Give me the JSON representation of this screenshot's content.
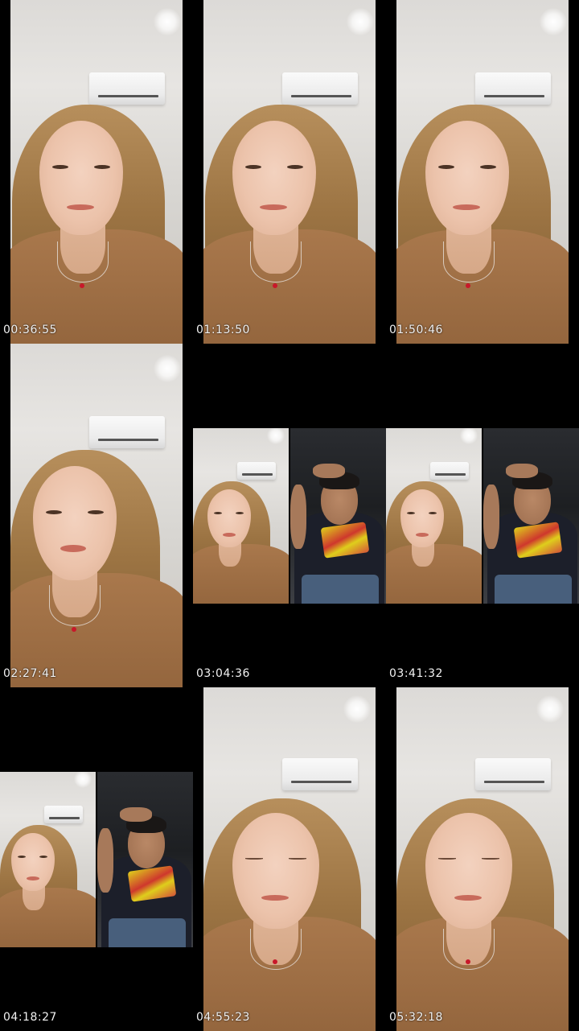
{
  "thumbnails": [
    {
      "timestamp": "00:36:55",
      "layout": "single",
      "eyes": "open"
    },
    {
      "timestamp": "01:13:50",
      "layout": "single",
      "eyes": "open"
    },
    {
      "timestamp": "01:50:46",
      "layout": "single",
      "eyes": "open"
    },
    {
      "timestamp": "02:27:41",
      "layout": "single",
      "eyes": "open"
    },
    {
      "timestamp": "03:04:36",
      "layout": "split",
      "eyes": "open"
    },
    {
      "timestamp": "03:41:32",
      "layout": "split",
      "eyes": "open"
    },
    {
      "timestamp": "04:18:27",
      "layout": "split",
      "eyes": "open"
    },
    {
      "timestamp": "04:55:23",
      "layout": "single",
      "eyes": "closed"
    },
    {
      "timestamp": "05:32:18",
      "layout": "single",
      "eyes": "closed"
    }
  ],
  "colors": {
    "background": "#000000",
    "timestamp_text": "#f2f2f2",
    "hair": "#9c7443",
    "shirt": "#93653d",
    "pendant": "#c8182a"
  }
}
